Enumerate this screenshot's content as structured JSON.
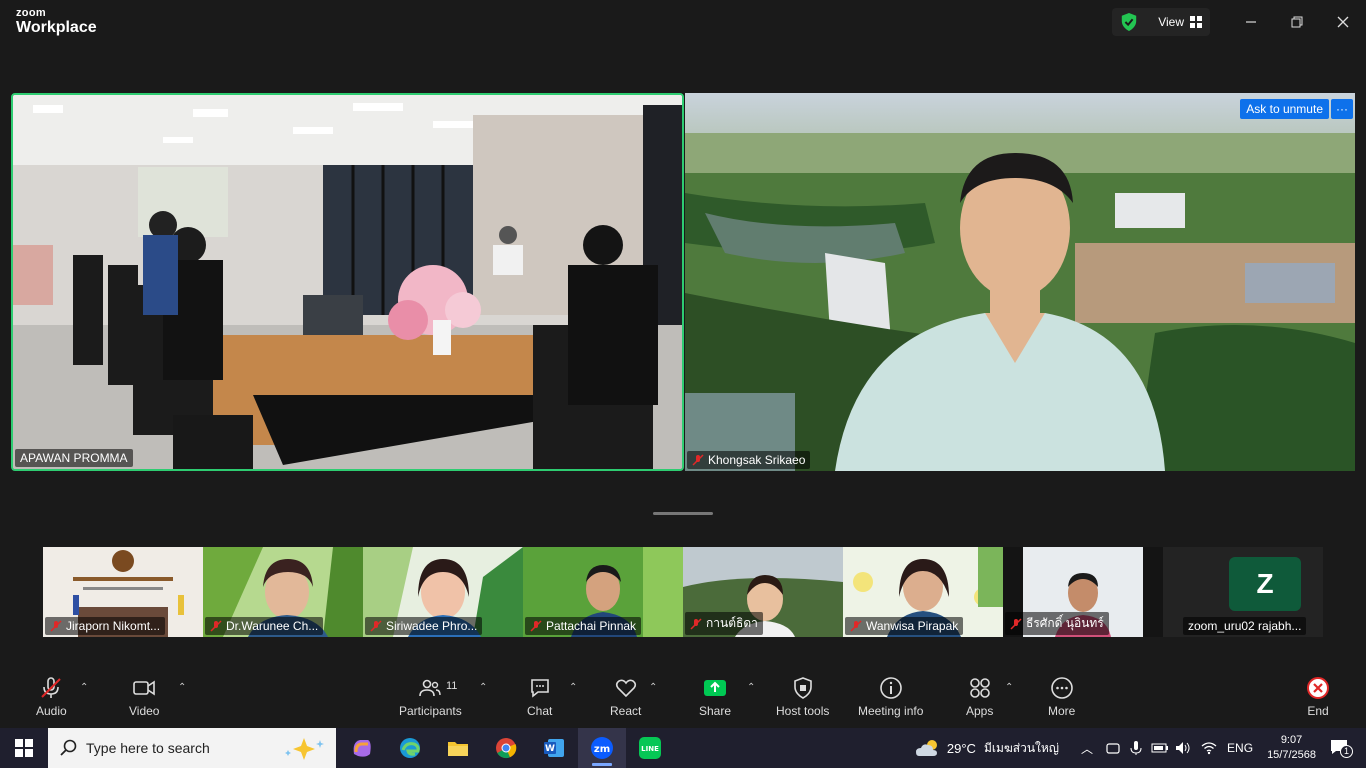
{
  "app": {
    "brand_line1": "zoom",
    "brand_line2": "Workplace"
  },
  "titlebar": {
    "view_label": "View"
  },
  "main_tiles": [
    {
      "name": "APAWAN PROMMA",
      "active_speaker": true
    },
    {
      "name": "Khongsak Srikaeo",
      "muted": true,
      "ask_unmute": "Ask to unmute",
      "more": "···"
    }
  ],
  "gallery": [
    {
      "name": "Jiraporn Nikomt...",
      "muted": true
    },
    {
      "name": "Dr.Warunee Ch...",
      "muted": true
    },
    {
      "name": "Siriwadee Phro...",
      "muted": true
    },
    {
      "name": "Pattachai Pinnak",
      "muted": true
    },
    {
      "name": "กานต์ธิดา",
      "muted": true
    },
    {
      "name": "Wanwisa Pirapak",
      "muted": true
    },
    {
      "name": "ธีรศักดิ์ นุอินทร์",
      "muted": true
    },
    {
      "name": "zoom_uru02 rajabh...",
      "muted": false,
      "avatar_letter": "Z"
    }
  ],
  "toolbar": {
    "audio": "Audio",
    "video": "Video",
    "participants": "Participants",
    "participants_count": "11",
    "chat": "Chat",
    "react": "React",
    "share": "Share",
    "host_tools": "Host tools",
    "meeting_info": "Meeting info",
    "apps": "Apps",
    "more": "More",
    "end": "End"
  },
  "taskbar": {
    "search_placeholder": "Type here to search",
    "weather_temp": "29°C",
    "weather_text": "มีเมฆส่วนใหญ่",
    "language": "ENG",
    "time": "9:07",
    "date": "15/7/2568",
    "notification_count": "1"
  },
  "colors": {
    "accent": "#0e71eb",
    "active_speaker": "#2ecc71",
    "share_green": "#00c853",
    "end_red": "#e02828"
  }
}
